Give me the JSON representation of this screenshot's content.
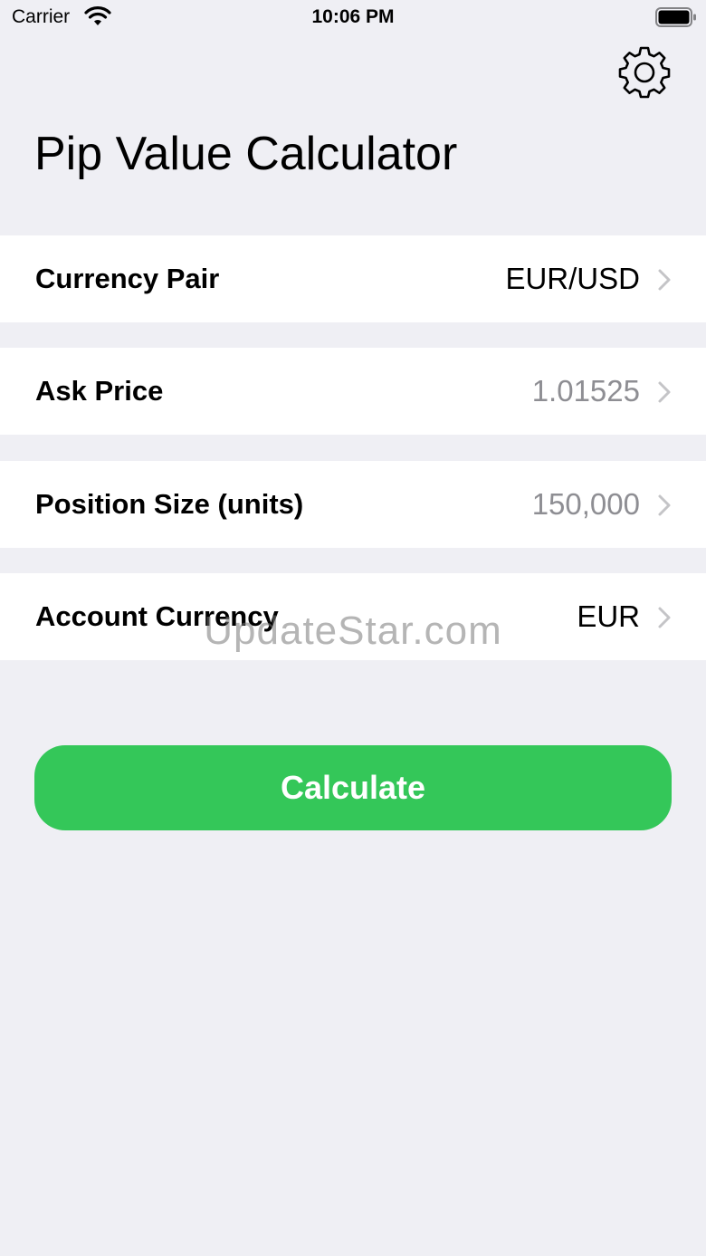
{
  "status_bar": {
    "carrier": "Carrier",
    "time": "10:06 PM",
    "icons": [
      "wifi-icon",
      "battery-icon"
    ]
  },
  "header": {
    "title": "Pip Value Calculator",
    "settings_icon": "gear-icon"
  },
  "rows": [
    {
      "label": "Currency Pair",
      "value": "EUR/USD",
      "value_style": "normal"
    },
    {
      "label": "Ask Price",
      "value": "1.01525",
      "value_style": "muted"
    },
    {
      "label": "Position Size (units)",
      "value": "150,000",
      "value_style": "muted"
    },
    {
      "label": "Account Currency",
      "value": "EUR",
      "value_style": "normal"
    }
  ],
  "watermark": "UpdateStar.com",
  "actions": {
    "calculate_label": "Calculate"
  },
  "colors": {
    "background": "#efeff4",
    "accent_green": "#34c759",
    "muted_text": "#8e8e93"
  }
}
